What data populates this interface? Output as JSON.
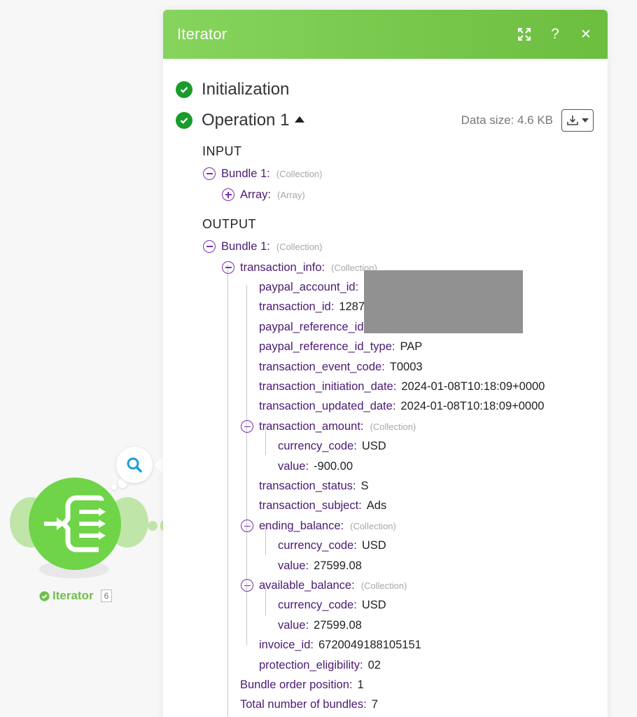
{
  "canvas": {
    "node_label": "Iterator",
    "node_badge": "6",
    "node_color": "#6fd448"
  },
  "panel": {
    "title": "Iterator",
    "header_color": "#78c84e",
    "icons": [
      "expand-icon",
      "help-icon",
      "close-icon"
    ],
    "help_label": "?",
    "close_label": "✕",
    "initialization_label": "Initialization",
    "operation_label": "Operation 1",
    "data_size": "Data size: 4.6 KB",
    "input_label": "INPUT",
    "output_label": "OUTPUT"
  },
  "input": {
    "bundle": {
      "key": "Bundle 1:",
      "type": "(Collection)"
    },
    "array": {
      "key": "Array:",
      "type": "(Array)"
    }
  },
  "output": {
    "bundle": {
      "key": "Bundle 1:",
      "type": "(Collection)"
    },
    "transaction_info": {
      "key": "transaction_info:",
      "type": "(Collection)"
    },
    "fields": [
      {
        "key": "paypal_account_id:",
        "val": ""
      },
      {
        "key": "transaction_id:",
        "val": "1287"
      },
      {
        "key": "paypal_reference_id",
        "val": ""
      },
      {
        "key": "paypal_reference_id_type:",
        "val": "PAP"
      },
      {
        "key": "transaction_event_code:",
        "val": "T0003"
      },
      {
        "key": "transaction_initiation_date:",
        "val": "2024-01-08T10:18:09+0000"
      },
      {
        "key": "transaction_updated_date:",
        "val": "2024-01-08T10:18:09+0000"
      }
    ],
    "transaction_amount": {
      "key": "transaction_amount:",
      "type": "(Collection)",
      "currency_key": "currency_code:",
      "currency_val": "USD",
      "value_key": "value:",
      "value_val": "-900.00"
    },
    "transaction_status": {
      "key": "transaction_status:",
      "val": "S"
    },
    "transaction_subject": {
      "key": "transaction_subject:",
      "val": "Ads"
    },
    "ending_balance": {
      "key": "ending_balance:",
      "type": "(Collection)",
      "currency_key": "currency_code:",
      "currency_val": "USD",
      "value_key": "value:",
      "value_val": "27599.08"
    },
    "available_balance": {
      "key": "available_balance:",
      "type": "(Collection)",
      "currency_key": "currency_code:",
      "currency_val": "USD",
      "value_key": "value:",
      "value_val": "27599.08"
    },
    "invoice_id": {
      "key": "invoice_id:",
      "val": "6720049188105151"
    },
    "protection_eligibility": {
      "key": "protection_eligibility:",
      "val": "02"
    },
    "bundle_order_position": {
      "key": "Bundle order position:",
      "val": "1"
    },
    "total_bundles": {
      "key": "Total number of bundles:",
      "val": "7"
    }
  }
}
